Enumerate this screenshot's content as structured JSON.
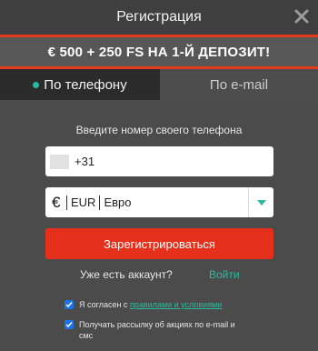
{
  "header": {
    "title": "Регистрация",
    "close_icon": "close-icon"
  },
  "promo": {
    "text": "€ 500 + 250 FS НА 1-Й ДЕПОЗИТ!"
  },
  "tabs": [
    {
      "label": "По телефону",
      "active": true
    },
    {
      "label": "По e-mail",
      "active": false
    }
  ],
  "form": {
    "instruction": "Введите номер своего телефона",
    "phone_value": "+31",
    "currency_sign": "€",
    "currency_code": "EUR",
    "currency_name": "Евро",
    "register_label": "Зарегистрироваться"
  },
  "account": {
    "text": "Уже есть аккаунт?",
    "login_label": "Войти"
  },
  "checkboxes": {
    "terms_prefix": "Я согласен с ",
    "terms_link": "правилами и условиями",
    "newsletter_line1": "Получать рассылку об акциях по e-mail и",
    "newsletter_line2": "смс"
  },
  "colors": {
    "accent": "#e5301c",
    "link": "#2cb8a0",
    "checkbox": "#1a73e8",
    "background": "#4b4b4b"
  }
}
